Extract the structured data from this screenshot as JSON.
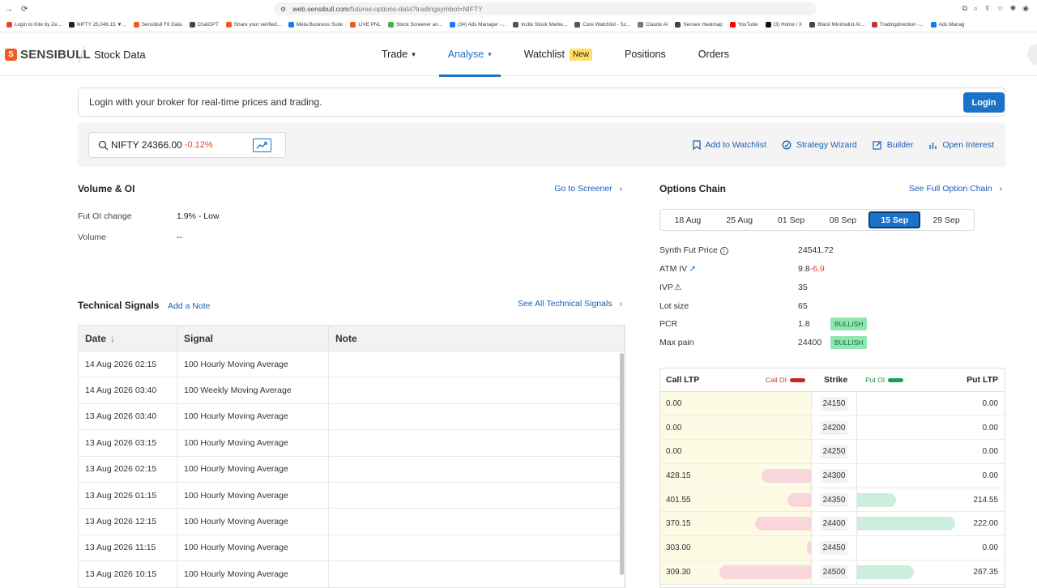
{
  "browser": {
    "url_host": "web.sensibull.com",
    "url_path": "/futures-options-data?tradingsymbol=NIFTY",
    "bookmarks": [
      {
        "label": "Login to Kite by Ze...",
        "color": "#e8462b"
      },
      {
        "label": "NIFTY 25,046.15 ▼...",
        "color": "#222222"
      },
      {
        "label": "Sensibull FII Data",
        "color": "#f15a22"
      },
      {
        "label": "ChatGPT",
        "color": "#444444"
      },
      {
        "label": "Share your verified...",
        "color": "#f15a22"
      },
      {
        "label": "Meta Business Suite",
        "color": "#1877f2"
      },
      {
        "label": "LIVE PNL",
        "color": "#f15a22"
      },
      {
        "label": "Stock Screener an...",
        "color": "#4caf50"
      },
      {
        "label": "(34) Ads Manager -...",
        "color": "#1877f2"
      },
      {
        "label": "Incite Stock Marke...",
        "color": "#555555"
      },
      {
        "label": "Core Watchlist - Sc...",
        "color": "#555555"
      },
      {
        "label": "Claude AI",
        "color": "#777777"
      },
      {
        "label": "Sensex Heatmap",
        "color": "#444444"
      },
      {
        "label": "YouTube",
        "color": "#ff0000"
      },
      {
        "label": "(3) Home / X",
        "color": "#111111"
      },
      {
        "label": "Black Minimalist Al...",
        "color": "#444444"
      },
      {
        "label": "Tradingdirection -...",
        "color": "#c0392b"
      },
      {
        "label": "Ads Manag",
        "color": "#1877f2"
      }
    ]
  },
  "app": {
    "logo_letter": "S",
    "logo_text": "SENSIBULL",
    "section": "Stock Data",
    "nav": [
      {
        "label": "Trade",
        "chevron": true,
        "active": false
      },
      {
        "label": "Analyse",
        "chevron": true,
        "active": true
      },
      {
        "label": "Watchlist",
        "badge": "New",
        "active": false
      },
      {
        "label": "Positions",
        "active": false
      },
      {
        "label": "Orders",
        "active": false
      }
    ]
  },
  "login_banner": {
    "text": "Login with your broker for real-time prices and trading.",
    "button": "Login"
  },
  "search": {
    "symbol": "NIFTY 24366.00",
    "change": "-0.12%"
  },
  "tools": {
    "watchlist": "Add to Watchlist",
    "strategy": "Strategy Wizard",
    "builder": "Builder",
    "oi": "Open Interest"
  },
  "volume_oi": {
    "title": "Volume & OI",
    "link": "Go to Screener",
    "fut_oi_label": "Fut OI change",
    "fut_oi_value": "1.9% - Low",
    "volume_label": "Volume",
    "volume_value": "--"
  },
  "technical": {
    "title": "Technical Signals",
    "add_note": "Add a Note",
    "see_all": "See All Technical Signals",
    "headers": {
      "date": "Date",
      "signal": "Signal",
      "note": "Note"
    },
    "rows": [
      {
        "date": "14 Aug 2026 02:15",
        "signal": "100 Hourly Moving Average"
      },
      {
        "date": "14 Aug 2026 03:40",
        "signal": "100 Weekly Moving Average"
      },
      {
        "date": "13 Aug 2026 03:40",
        "signal": "100 Hourly Moving Average"
      },
      {
        "date": "13 Aug 2026 03:15",
        "signal": "100 Hourly Moving Average"
      },
      {
        "date": "13 Aug 2026 02:15",
        "signal": "100 Hourly Moving Average"
      },
      {
        "date": "13 Aug 2026 01:15",
        "signal": "100 Hourly Moving Average"
      },
      {
        "date": "13 Aug 2026 12:15",
        "signal": "100 Hourly Moving Average"
      },
      {
        "date": "13 Aug 2026 11:15",
        "signal": "100 Hourly Moving Average"
      },
      {
        "date": "13 Aug 2026 10:15",
        "signal": "100 Hourly Moving Average"
      }
    ]
  },
  "options_chain": {
    "title": "Options Chain",
    "see_full": "See Full Option Chain",
    "expiries": [
      "18 Aug",
      "25 Aug",
      "01 Sep",
      "08 Sep",
      "15 Sep",
      "29 Sep"
    ],
    "selected_expiry": "15 Sep",
    "stats": {
      "synth_label": "Synth Fut Price",
      "synth_value": "24541.72",
      "atm_label": "ATM IV",
      "atm_value": "9.8",
      "atm_change": "-6.9",
      "ivp_label": "IVP",
      "ivp_value": "35",
      "lot_label": "Lot size",
      "lot_value": "65",
      "pcr_label": "PCR",
      "pcr_value": "1.8",
      "pcr_badge": "BULLISH",
      "maxpain_label": "Max pain",
      "maxpain_value": "24400",
      "maxpain_badge": "BULLISH"
    },
    "table_headers": {
      "call_ltp": "Call LTP",
      "call_oi": "Call OI",
      "strike": "Strike",
      "put_oi": "Put OI",
      "put_ltp": "Put LTP"
    },
    "rows": [
      {
        "call": "0.00",
        "strike": "24150",
        "put": "0.00",
        "call_oi": 0,
        "put_oi": 0
      },
      {
        "call": "0.00",
        "strike": "24200",
        "put": "0.00",
        "call_oi": 0,
        "put_oi": 0
      },
      {
        "call": "0.00",
        "strike": "24250",
        "put": "0.00",
        "call_oi": 0,
        "put_oi": 0
      },
      {
        "call": "428.15",
        "strike": "24300",
        "put": "0.00",
        "call_oi": 0.54,
        "put_oi": 0
      },
      {
        "call": "401.55",
        "strike": "24350",
        "put": "214.55",
        "call_oi": 0.26,
        "put_oi": 0.39
      },
      {
        "call": "370.15",
        "strike": "24400",
        "put": "222.00",
        "call_oi": 0.61,
        "put_oi": 0.99
      },
      {
        "call": "303.00",
        "strike": "24450",
        "put": "0.00",
        "call_oi": 0.04,
        "put_oi": 0
      },
      {
        "call": "309.30",
        "strike": "24500",
        "put": "267.35",
        "call_oi": 1.0,
        "put_oi": 0.57
      }
    ]
  }
}
